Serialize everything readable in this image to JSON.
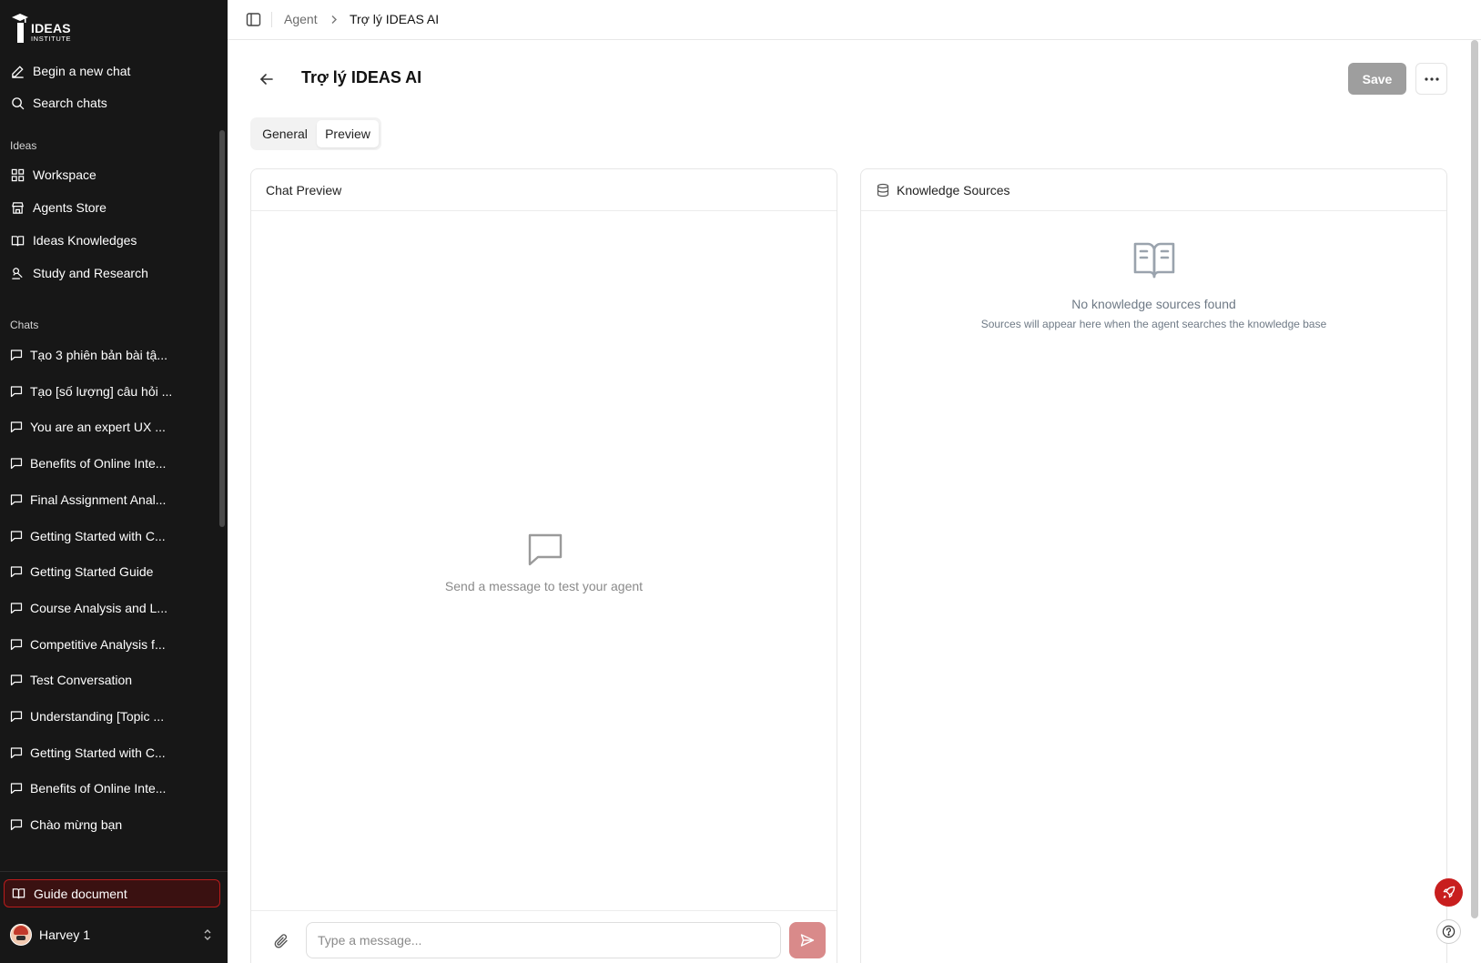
{
  "brand": {
    "logo_text": "IDEAS",
    "logo_sub": "INSTITUTE"
  },
  "sidebar": {
    "top_actions": [
      {
        "label": "Begin a new chat",
        "icon": "pencil-icon"
      },
      {
        "label": "Search chats",
        "icon": "search-icon"
      }
    ],
    "ideas_label": "Ideas",
    "ideas_items": [
      {
        "label": "Workspace",
        "icon": "grid-icon"
      },
      {
        "label": "Agents Store",
        "icon": "store-icon"
      },
      {
        "label": "Ideas Knowledges",
        "icon": "book-open-icon"
      },
      {
        "label": "Study and Research",
        "icon": "research-icon"
      }
    ],
    "chats_label": "Chats",
    "chats": [
      "Tạo 3 phiên bản bài tậ...",
      "Tạo [số lượng] câu hỏi ...",
      "You are an expert UX ...",
      "Benefits of Online Inte...",
      "Final Assignment Anal...",
      "Getting Started with C...",
      "Getting Started Guide",
      "Course Analysis and L...",
      "Competitive Analysis f...",
      "Test Conversation",
      "Understanding [Topic ...",
      "Getting Started with C...",
      "Benefits of Online Inte...",
      "Chào mừng bạn"
    ],
    "guide_label": "Guide document",
    "user_name": "Harvey 1"
  },
  "breadcrumb": {
    "parent": "Agent",
    "current": "Trợ lý IDEAS AI"
  },
  "header": {
    "title": "Trợ lý IDEAS AI",
    "save_label": "Save"
  },
  "tabs": [
    {
      "label": "General",
      "active": false
    },
    {
      "label": "Preview",
      "active": true
    }
  ],
  "chat_preview": {
    "title": "Chat Preview",
    "empty_text": "Send a message to test your agent",
    "input_placeholder": "Type a message..."
  },
  "knowledge": {
    "title": "Knowledge Sources",
    "empty_title": "No knowledge sources found",
    "empty_sub": "Sources will appear here when the agent searches the knowledge base"
  },
  "colors": {
    "sidebar_bg": "#171717",
    "accent_red": "#c81e1e",
    "save_disabled": "#9e9e9e",
    "send_disabled": "#d98a8a"
  }
}
